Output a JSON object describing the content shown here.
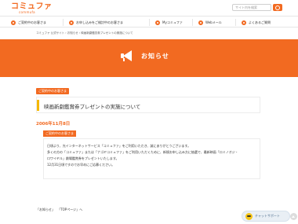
{
  "header": {
    "logo_text": "コミュファ",
    "logo_sub": "commufa",
    "search_placeholder": "サイト内を検索"
  },
  "nav": {
    "items": [
      {
        "label": "ご契約中のお客さま"
      },
      {
        "label": "お申し込みをご検討中のお客さま"
      },
      {
        "label": "Myコミュファ"
      },
      {
        "label": "Webメール"
      },
      {
        "label": "よくあるご質問"
      }
    ]
  },
  "breadcrumb": "コミュファ 公式サイト › お知らせ › 映画新劇鑑賞券プレゼントの実施について",
  "banner": {
    "title": "お知らせ"
  },
  "article": {
    "category": "ご契約中のお客さま",
    "title": "映画新劇鑑賞券プレゼントの実施について",
    "date": "2006年11月8日",
    "inner_category": "ご契約中のお客さま",
    "body": [
      "日頃より、光インターネットサービス「コミュファ」をご利用いただき、誠にありがとうございます。",
      "多くの方の「コミュファ」または「ナゴヤコミュファ」をご利用いただくために、新規お申し込み方に抽選で、最新映画「ロミノオジ・",
      "ロワイヤル」劇場鑑賞券をプレゼントいたします。",
      "12月31日頃ですのでお早めにご応募ください。"
    ]
  },
  "footer": {
    "links": [
      "「お知らせ」",
      "「TOPページ」へ"
    ]
  },
  "chat_widget": {
    "label": "チャットサポート"
  },
  "colors": {
    "accent": "#f26a21",
    "title_bar": "#f5b800"
  },
  "icons": {
    "banner": "megaphone-icon",
    "search": "search-icon",
    "chat": "chat-icon"
  }
}
